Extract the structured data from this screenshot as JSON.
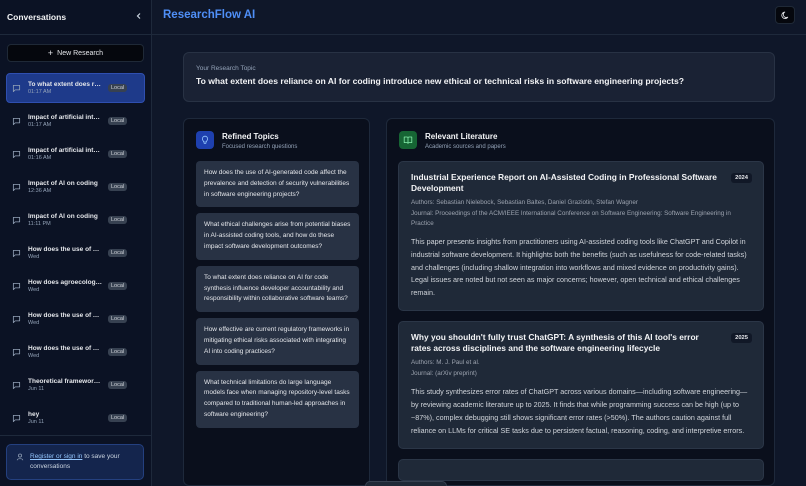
{
  "sidebar": {
    "title": "Conversations",
    "new_label": "New Research",
    "conversations": [
      {
        "title": "To what extent does reliance on AI for coding introduce new ethical or technical risks",
        "time": "01:17 AM",
        "badge": "Local",
        "active": true
      },
      {
        "title": "Impact of artificial intelligence on software engineering",
        "time": "01:17 AM",
        "badge": "Local"
      },
      {
        "title": "Impact of artificial intelligence on coding",
        "time": "01:16 AM",
        "badge": "Local"
      },
      {
        "title": "Impact of AI on coding",
        "time": "12:36 AM",
        "badge": "Local"
      },
      {
        "title": "Impact of AI on coding",
        "time": "11:11 PM",
        "badge": "Local"
      },
      {
        "title": "How does the use of AI-generated code affect security",
        "time": "Wed",
        "badge": "Local"
      },
      {
        "title": "How does agroecology influence sustainable farming",
        "time": "Wed",
        "badge": "Local"
      },
      {
        "title": "How does the use of AI tools affect developers",
        "time": "Wed",
        "badge": "Local"
      },
      {
        "title": "How does the use of AI in education affect learning",
        "time": "Wed",
        "badge": "Local"
      },
      {
        "title": "Theoretical framework for research",
        "time": "Jun 11",
        "badge": "Local"
      },
      {
        "title": "hey",
        "time": "Jun 11",
        "badge": "Local"
      }
    ],
    "signin": {
      "register_link": "Register or sign in",
      "rest": " to save your conversations"
    }
  },
  "header": {
    "brand": "ResearchFlow AI"
  },
  "topic": {
    "label": "Your Research Topic",
    "question": "To what extent does reliance on AI for coding introduce new ethical or technical risks in software engineering projects?"
  },
  "refined": {
    "title": "Refined Topics",
    "subtitle": "Focused research questions",
    "items": [
      "How does the use of AI-generated code affect the prevalence and detection of security vulnerabilities in software engineering projects?",
      "What ethical challenges arise from potential biases in AI-assisted coding tools, and how do these impact software development outcomes?",
      "To what extent does reliance on AI for code synthesis influence developer accountability and responsibility within collaborative software teams?",
      "How effective are current regulatory frameworks in mitigating ethical risks associated with integrating AI into coding practices?",
      "What technical limitations do large language models face when managing repository-level tasks compared to traditional human-led approaches in software engineering?"
    ]
  },
  "literature": {
    "title": "Relevant Literature",
    "subtitle": "Academic sources and papers",
    "papers": [
      {
        "title": "Industrial Experience Report on AI-Assisted Coding in Professional Software Development",
        "year": "2024",
        "authors": "Authors: Sebastian Nielebock, Sebastian Baltes, Daniel Graziotin, Stefan Wagner",
        "journal": "Journal: Proceedings of the ACM/IEEE International Conference on Software Engineering: Software Engineering in Practice",
        "abstract": "This paper presents insights from practitioners using AI-assisted coding tools like ChatGPT and Copilot in industrial software development. It highlights both the benefits (such as usefulness for code-related tasks) and challenges (including shallow integration into workflows and mixed evidence on productivity gains). Legal issues are noted but not seen as major concerns; however, open technical and ethical challenges remain."
      },
      {
        "title": "Why you shouldn't fully trust ChatGPT: A synthesis of this AI tool's error rates across disciplines and the software engineering lifecycle",
        "year": "2025",
        "authors": "Authors: M. J. Paul et al.",
        "journal": "Journal: (arXiv preprint)",
        "abstract": "This study synthesizes error rates of ChatGPT across various domains—including software engineering—by reviewing academic literature up to 2025. It finds that while programming success can be high (up to ~87%), complex debugging still shows significant error rates (>50%). The authors caution against full reliance on LLMs for critical SE tasks due to persistent factual, reasoning, coding, and interpretive errors."
      }
    ]
  },
  "colors": {
    "background": "#0f1729",
    "brand": "#4f8ff7",
    "active_conversation": "#1e3a8a",
    "card": "#1f2938"
  }
}
